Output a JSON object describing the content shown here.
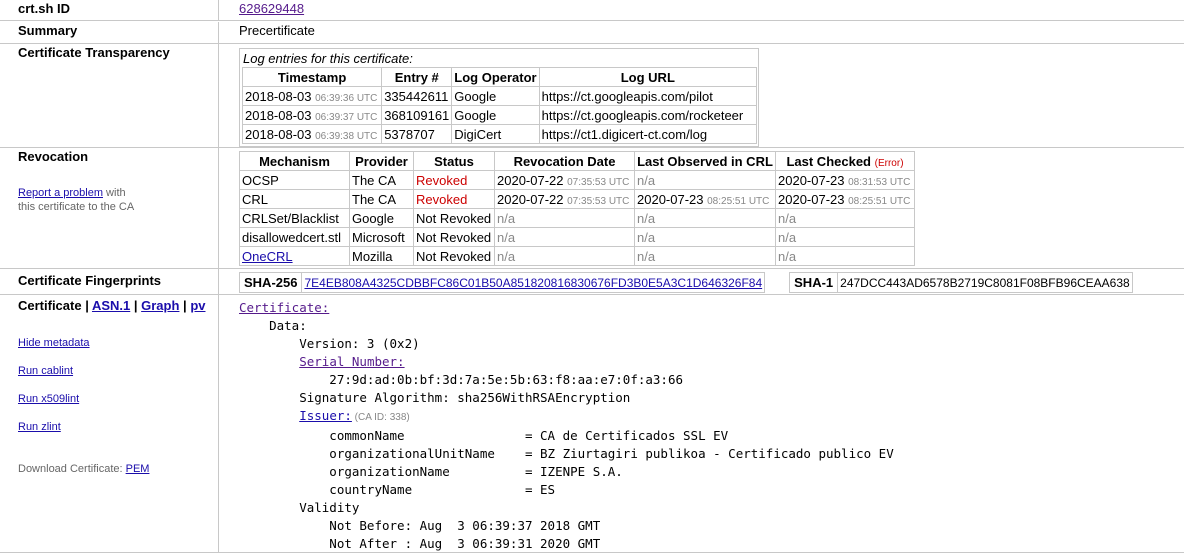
{
  "crtsh": {
    "label": "crt.sh ID",
    "id": "628629448"
  },
  "summary": {
    "label": "Summary",
    "value": "Precertificate"
  },
  "ct": {
    "label": "Certificate Transparency",
    "caption": "Log entries for this certificate:",
    "headers": [
      "Timestamp",
      "Entry #",
      "Log Operator",
      "Log URL"
    ],
    "rows": [
      {
        "date": "2018-08-03",
        "time": "06:39:36 UTC",
        "entry": "335442611",
        "operator": "Google",
        "url": "https://ct.googleapis.com/pilot"
      },
      {
        "date": "2018-08-03",
        "time": "06:39:37 UTC",
        "entry": "368109161",
        "operator": "Google",
        "url": "https://ct.googleapis.com/rocketeer"
      },
      {
        "date": "2018-08-03",
        "time": "06:39:38 UTC",
        "entry": "5378707",
        "operator": "DigiCert",
        "url": "https://ct1.digicert-ct.com/log"
      }
    ]
  },
  "revocation": {
    "label": "Revocation",
    "report_link": "Report a problem",
    "report_text_1": " with",
    "report_text_2": "this certificate to the CA",
    "headers": [
      "Mechanism",
      "Provider",
      "Status",
      "Revocation Date",
      "Last Observed in CRL",
      "Last Checked"
    ],
    "last_checked_note": "(Error)",
    "rows": [
      {
        "mechanism": "OCSP",
        "provider": "The CA",
        "status": "Revoked",
        "rev_date": "2020-07-22",
        "rev_time": "07:35:53 UTC",
        "obs_date": "n/a",
        "obs_time": "",
        "chk_date": "2020-07-23",
        "chk_time": "08:31:53 UTC"
      },
      {
        "mechanism": "CRL",
        "provider": "The CA",
        "status": "Revoked",
        "rev_date": "2020-07-22",
        "rev_time": "07:35:53 UTC",
        "obs_date": "2020-07-23",
        "obs_time": "08:25:51 UTC",
        "chk_date": "2020-07-23",
        "chk_time": "08:25:51 UTC"
      },
      {
        "mechanism": "CRLSet/Blacklist",
        "provider": "Google",
        "status": "Not Revoked",
        "rev_date": "n/a",
        "rev_time": "",
        "obs_date": "n/a",
        "obs_time": "",
        "chk_date": "n/a",
        "chk_time": ""
      },
      {
        "mechanism": "disallowedcert.stl",
        "provider": "Microsoft",
        "status": "Not Revoked",
        "rev_date": "n/a",
        "rev_time": "",
        "obs_date": "n/a",
        "obs_time": "",
        "chk_date": "n/a",
        "chk_time": ""
      },
      {
        "mechanism": "OneCRL",
        "provider": "Mozilla",
        "status": "Not Revoked",
        "rev_date": "n/a",
        "rev_time": "",
        "obs_date": "n/a",
        "obs_time": "",
        "chk_date": "n/a",
        "chk_time": ""
      }
    ]
  },
  "fingerprints": {
    "label": "Certificate Fingerprints",
    "sha256_label": "SHA-256",
    "sha256": "7E4EB808A4325CDBBFC86C01B50A851820816830676FD3B0E5A3C1D646326F84",
    "sha1_label": "SHA-1",
    "sha1": "247DCC443AD6578B2719C8081F08BFB96CEAA638"
  },
  "certificate": {
    "label": "Certificate",
    "sep": " | ",
    "asn1": "ASN.1",
    "graph": "Graph",
    "pv": "pv",
    "side_links": [
      "Hide metadata",
      "Run cablint",
      "Run x509lint",
      "Run zlint"
    ],
    "download_text": "Download Certificate: ",
    "download_link": "PEM",
    "cert_link": "Certificate:",
    "data_line": "    Data:",
    "version_line": "        Version: 3 (0x2)",
    "serial_link": "Serial Number:",
    "serial_value": "            27:9d:ad:0b:bf:3d:7a:5e:5b:63:f8:aa:e7:0f:a3:66",
    "sig_line": "        Signature Algorithm: sha256WithRSAEncryption",
    "issuer_link": "Issuer:",
    "issuer_caid": " (CA ID: 338)",
    "issuer_lines": [
      "            commonName                = CA de Certificados SSL EV",
      "            organizationalUnitName    = BZ Ziurtagiri publikoa - Certificado publico EV",
      "            organizationName          = IZENPE S.A.",
      "            countryName               = ES"
    ],
    "validity_line": "        Validity",
    "not_before": "            Not Before: Aug  3 06:39:37 2018 GMT",
    "not_after": "            Not After : Aug  3 06:39:31 2020 GMT"
  }
}
